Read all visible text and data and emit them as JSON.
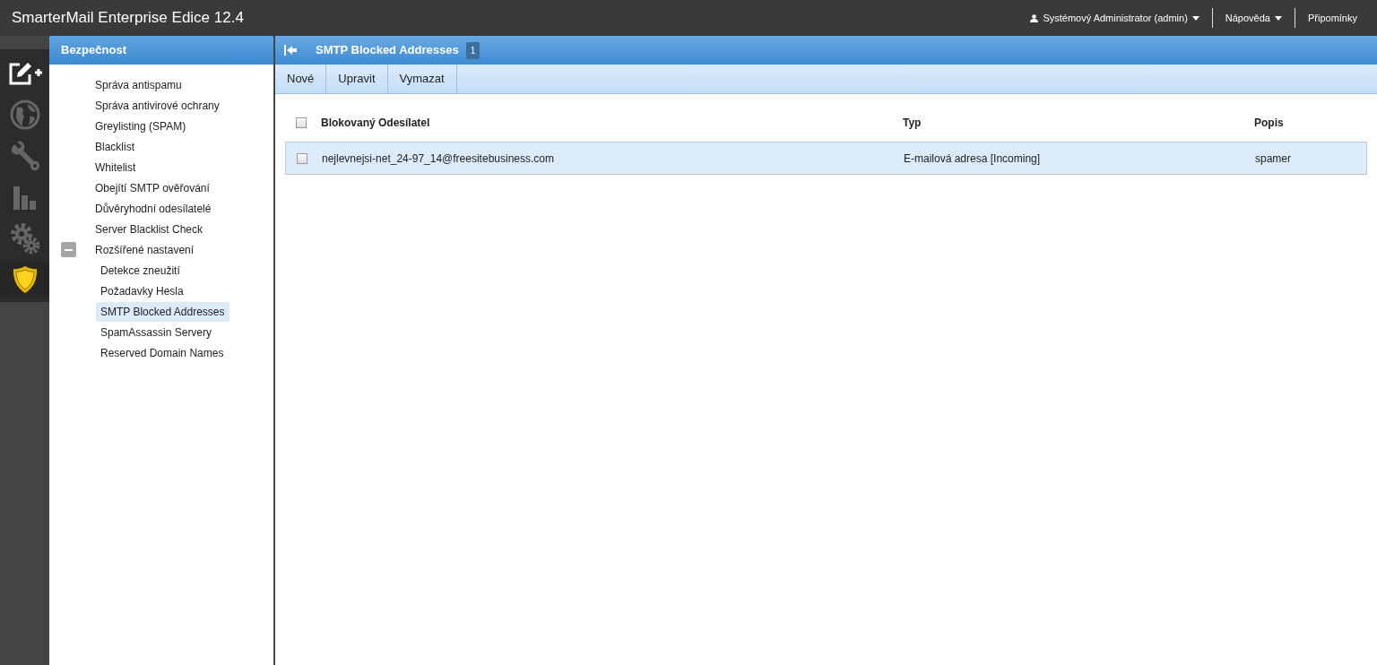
{
  "app_title": "SmarterMail Enterprise Edice 12.4",
  "top_menu": [
    {
      "kind": "user",
      "label": "Systémový Administrator (admin)",
      "dropdown": true
    },
    {
      "kind": "plain",
      "label": "Nápověda",
      "dropdown": true
    },
    {
      "kind": "plain",
      "label": "Připomínky",
      "dropdown": false
    }
  ],
  "nav_rail": [
    {
      "kind": "compose",
      "selected": false
    },
    {
      "kind": "globe",
      "selected": false
    },
    {
      "kind": "wrench",
      "selected": false
    },
    {
      "kind": "chart",
      "selected": false
    },
    {
      "kind": "gears",
      "selected": false
    },
    {
      "kind": "shield",
      "selected": true
    }
  ],
  "sidebar": {
    "title": "Bezpečnost",
    "items": [
      {
        "label": "Správa antispamu",
        "selected": false
      },
      {
        "label": "Správa antivirové ochrany",
        "selected": false
      },
      {
        "label": "Greylisting (SPAM)",
        "selected": false
      },
      {
        "label": "Blacklist",
        "selected": false
      },
      {
        "label": "Whitelist",
        "selected": false
      },
      {
        "label": "Obejítí SMTP ověřování",
        "selected": false
      },
      {
        "label": "Důvěryhodní odesílatelé",
        "selected": false
      },
      {
        "label": "Server Blacklist Check",
        "selected": false
      },
      {
        "label": "Rozšířené nastavení",
        "selected": false,
        "expanded": true,
        "children": [
          {
            "label": "Detekce zneužití",
            "selected": false
          },
          {
            "label": "Požadavky Hesla",
            "selected": false
          },
          {
            "label": "SMTP Blocked Addresses",
            "selected": true
          },
          {
            "label": "SpamAssassin Servery",
            "selected": false
          },
          {
            "label": "Reserved Domain Names",
            "selected": false
          }
        ]
      }
    ]
  },
  "main": {
    "title": "SMTP Blocked Addresses",
    "count": "1",
    "toolbar": [
      "Nové",
      "Upravit",
      "Vymazat"
    ],
    "table": {
      "columns": [
        "Blokovaný Odesílatel",
        "Typ",
        "Popis"
      ],
      "header_checked": false,
      "rows": [
        {
          "cells": [
            "nejlevnejsi-net_24-97_14@freesitebusiness.com",
            "E-mailová adresa [Incoming]",
            "spamer"
          ],
          "checked": false,
          "selected": true
        }
      ]
    }
  }
}
